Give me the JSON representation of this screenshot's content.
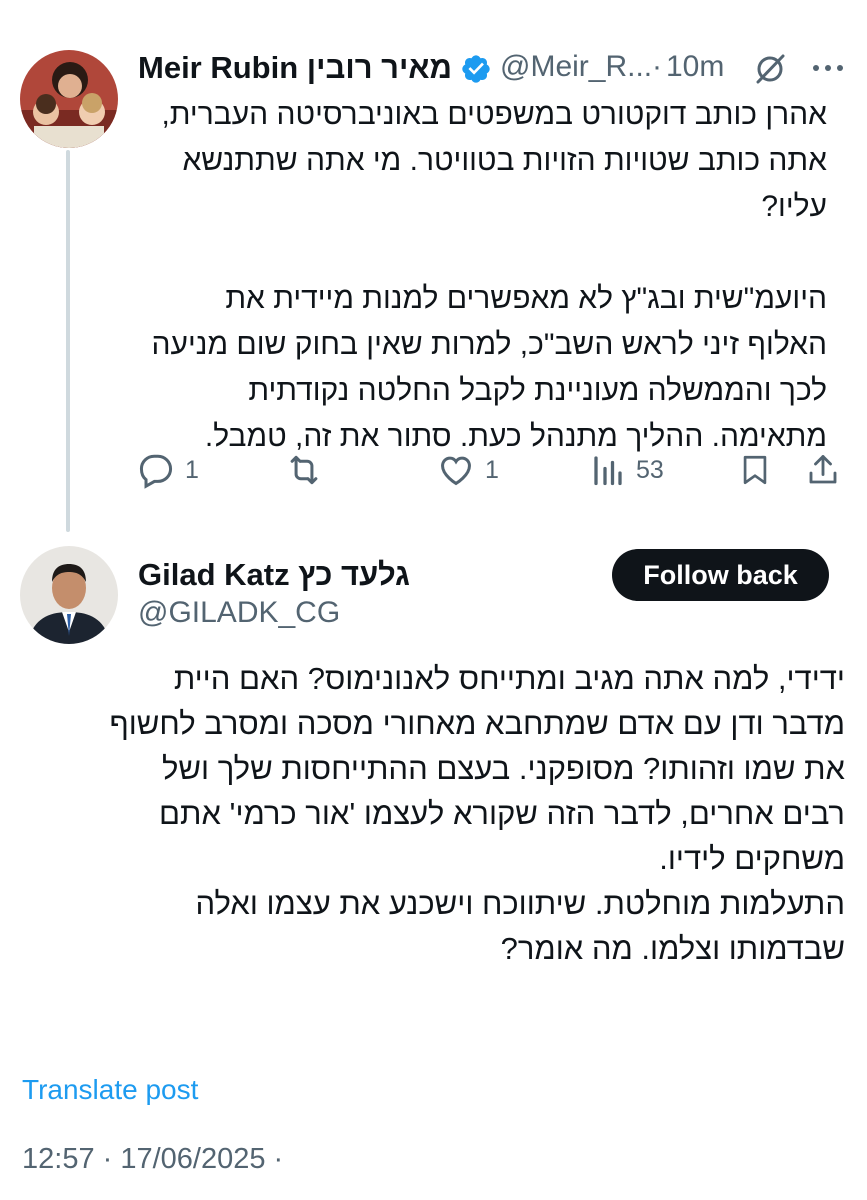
{
  "tweet1": {
    "author_name": "Meir Rubin מאיר רובין",
    "handle": "@Meir_R...",
    "separator": "·",
    "time": "10m",
    "text": "אהרן כותב דוקטורט במשפטים באוניברסיטה העברית,\nאתה כותב שטויות הזויות בטוויטר. מי אתה שתתנשא\nעליו?\n\nהיועמ\"שית ובג\"ץ לא מאפשרים למנות מיידית את\nהאלוף זיני לראש השב\"כ, למרות שאין בחוק שום מניעה\nלכך והממשלה מעוניינת לקבל החלטה נקודתית\nמתאימה. ההליך מתנהל כעת. סתור את זה, טמבל.",
    "replies": "1",
    "likes": "1",
    "views": "53",
    "verified_color": "#1d9bf0"
  },
  "tweet2": {
    "author_name": "Gilad Katz גלעד כץ",
    "handle": "@GILADK_CG",
    "follow_label": "Follow back",
    "text": "ידידי, למה אתה מגיב ומתייחס לאנונימוס? האם היית\nמדבר ודן עם אדם שמתחבא מאחורי מסכה ומסרב לחשוף\nאת שמו וזהותו? מסופקני. בעצם ההתייחסות שלך ושל\nרבים אחרים, לדבר הזה שקורא לעצמו 'אור כרמי' אתם\nמשחקים לידיו.\nהתעלמות מוחלטת. שיתווכח וישכנע את עצמו ואלה\nשבדמותו וצלמו. מה אומר?",
    "translate_label": "Translate post",
    "timestamp": "12:57 · 17/06/2025 ·"
  },
  "colors": {
    "text": "#0f1419",
    "secondary": "#536471",
    "link": "#1d9bf0",
    "thread_line": "#cfd9de"
  },
  "icons": [
    "verified-badge-icon",
    "grok-icon",
    "more-icon",
    "reply-icon",
    "retweet-icon",
    "like-icon",
    "views-icon",
    "bookmark-icon",
    "share-icon"
  ]
}
